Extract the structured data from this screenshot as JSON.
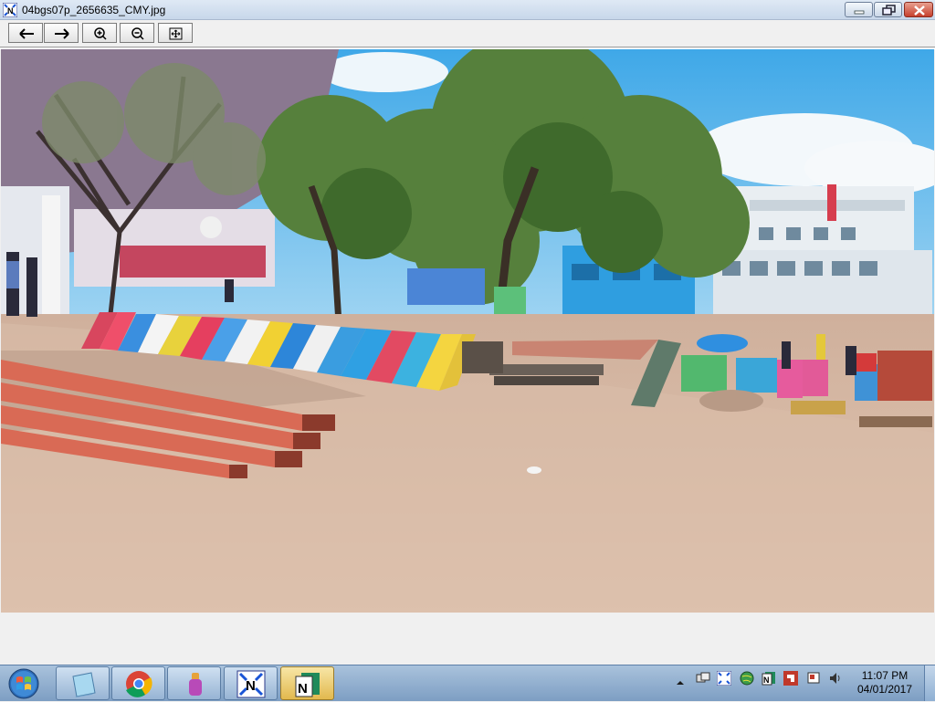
{
  "window": {
    "title": "04bgs07p_2656635_CMY.jpg",
    "controls": {
      "minimize": "minimize-icon",
      "maximize": "maximize-icon",
      "close": "close-icon"
    }
  },
  "toolbar": {
    "buttons": [
      {
        "name": "previous-button",
        "icon": "arrow-left-icon"
      },
      {
        "name": "next-button",
        "icon": "arrow-right-icon"
      },
      {
        "name": "zoom-in-button",
        "icon": "zoom-in-icon"
      },
      {
        "name": "zoom-out-button",
        "icon": "zoom-out-icon"
      },
      {
        "name": "fit-to-window-button",
        "icon": "fit-window-icon"
      }
    ]
  },
  "image": {
    "content": "outdoor-photo",
    "colors": {
      "sky": "#5fb3e6",
      "ground": "#d6b8a4",
      "foliage": "#4f7a38"
    }
  },
  "taskbar": {
    "pinned": [
      {
        "name": "start-button",
        "icon": "windows-logo-icon"
      },
      {
        "name": "taskbar-app-notes",
        "icon": "notes-icon"
      },
      {
        "name": "taskbar-app-chrome",
        "icon": "chrome-icon"
      },
      {
        "name": "taskbar-app-tool",
        "icon": "bottle-icon"
      },
      {
        "name": "taskbar-app-viewer",
        "icon": "viewer-n-icon"
      },
      {
        "name": "taskbar-app-editor",
        "icon": "editor-n-icon",
        "active": true
      }
    ],
    "tray": [
      "show-hidden-icons-icon",
      "network-icon",
      "viewer-tray-icon",
      "globe-icon",
      "n-tray-icon",
      "shortcut-icon",
      "flag-icon",
      "volume-icon"
    ],
    "clock": {
      "time": "11:07 PM",
      "date": "04/01/2017"
    }
  }
}
